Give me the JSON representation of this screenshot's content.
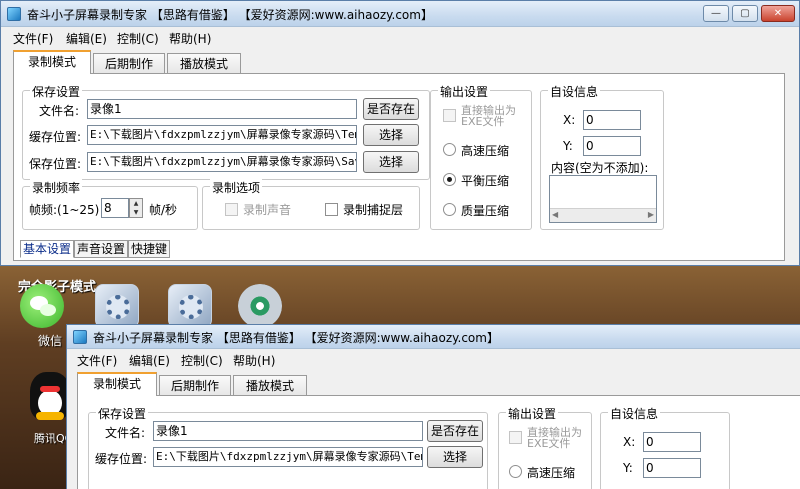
{
  "colors": {
    "accent_tab": "#f0a030",
    "title_gradient_top": "#e4eef9",
    "close_button": "#c9432e",
    "desktop": "#6b4a2c"
  },
  "main_window": {
    "title": "奋斗小子屏幕录制专家 【思路有借鉴】 【爱好资源网:www.aihaozy.com】",
    "controls": {
      "minimize": "—",
      "maximize": "▢",
      "close": "✕"
    },
    "menu": [
      "文件(F)",
      "编辑(E)",
      "控制(C)",
      "帮助(H)"
    ],
    "tabs": [
      "录制模式",
      "后期制作",
      "播放模式"
    ],
    "save_settings": {
      "title": "保存设置",
      "filename_label": "文件名:",
      "filename_value": "录像1",
      "exists_button": "是否存在",
      "cache_label": "缓存位置:",
      "cache_value": "E:\\下载图片\\fdxzpmlzzjym\\屏幕录像专家源码\\TempFi",
      "choose_button": "选择",
      "save_label": "保存位置:",
      "save_value": "E:\\下载图片\\fdxzpmlzzjym\\屏幕录像专家源码\\SaveFi",
      "choose_button2": "选择"
    },
    "output_settings": {
      "title": "输出设置",
      "direct_exe": "直接输出为EXE文件",
      "options": [
        "高速压缩",
        "平衡压缩",
        "质量压缩"
      ],
      "selected": "平衡压缩"
    },
    "custom_info": {
      "title": "自设信息",
      "x_label": "X:",
      "x_value": "0",
      "y_label": "Y:",
      "y_value": "0",
      "content_label": "内容(空为不添加):"
    },
    "frame_rate": {
      "title": "录制频率",
      "label": "帧频:(1~25)",
      "value": "8",
      "unit": "帧/秒"
    },
    "record_options": {
      "title": "录制选项",
      "record_sound": "录制声音",
      "record_cursor": "录制捕捉层"
    },
    "subtabs": [
      "基本设置",
      "声音设置",
      "快捷键"
    ]
  },
  "desktop": {
    "shadow_label": "完全影子模式",
    "icons": [
      {
        "name": "wechat",
        "label": "微信"
      },
      {
        "name": "settings-1",
        "label": ""
      },
      {
        "name": "settings-2",
        "label": ""
      },
      {
        "name": "media",
        "label": ""
      },
      {
        "name": "qq",
        "label": "腾讯QQ"
      }
    ]
  },
  "second_window": {
    "title": "奋斗小子屏幕录制专家 【思路有借鉴】 【爱好资源网:www.aihaozy.com】",
    "menu": [
      "文件(F)",
      "编辑(E)",
      "控制(C)",
      "帮助(H)"
    ],
    "tabs": [
      "录制模式",
      "后期制作",
      "播放模式"
    ],
    "save_settings": {
      "title": "保存设置",
      "filename_label": "文件名:",
      "filename_value": "录像1",
      "exists_button": "是否存在",
      "cache_label": "缓存位置:",
      "cache_value": "E:\\下载图片\\fdxzpmlzzjym\\屏幕录像专家源码\\TempFi",
      "choose_button": "选择"
    },
    "output_settings": {
      "title": "输出设置",
      "direct_exe": "直接输出为EXE文件",
      "first_option": "高速压缩"
    },
    "custom_info": {
      "title": "自设信息",
      "x_label": "X:",
      "x_value": "0",
      "y_label": "Y:",
      "y_value": "0"
    }
  }
}
